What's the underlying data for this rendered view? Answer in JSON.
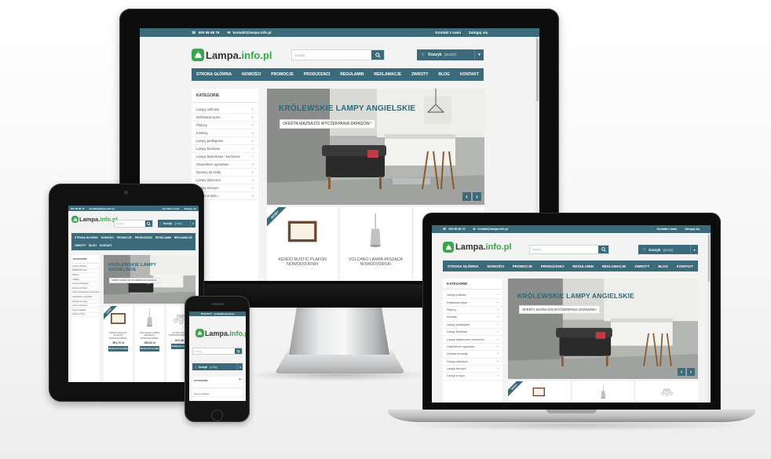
{
  "site": {
    "phone": "600 86 86 76",
    "email": "kontakt@lampa.info.pl",
    "contact_link": "Kontakt z nami",
    "login_link": "Zaloguj się",
    "logo_left": "Lampa.",
    "logo_right": "info.pl",
    "search_placeholder": "Szukaj",
    "cart_label": "Koszyk",
    "cart_state": "(pusty)",
    "nav": [
      "STRONA GŁÓWNA",
      "NOWOŚCI",
      "PROMOCJE",
      "PRODUCENCI",
      "REGULAMIN",
      "REKLAMACJE",
      "ZWROTY",
      "BLOG",
      "KONTAKT"
    ],
    "categories_title": "KATEGORIE",
    "categories": [
      "Lampy sufitowe",
      "Reflektorki tysze",
      "Plafony",
      "Kinkiety",
      "Lampy podłogowe",
      "Lampy biurkowe",
      "Lampy łazienkowe i kuchenne",
      "Oświetlenie ogrodowe",
      "Oprawy do szafy",
      "Lampy dziecięce",
      "Lampy wiszące",
      "Lampy w stylu"
    ],
    "banner_title": "KRÓLEWSKIE LAMPY ANGIELSKIE",
    "banner_subtitle": "OFERTA WAŻNA DO WYCZERPANIA ZAPASÓW !",
    "arrow_prev": "‹",
    "arrow_next": "›",
    "ribbon": "NOWY",
    "products": [
      {
        "name": "KENDO RUSTIC PLAFON NOWODVORSKI",
        "price": "391,72 zł"
      },
      {
        "name": "VOLCANO LAMPA WISZĄCA NOWODVORSKI",
        "price": "190,02 zł"
      },
      {
        "name": "COSTA PLAFON NOWODVORSKI 4122",
        "price": "317,34 zł"
      }
    ],
    "add_to_cart": "Dodaj do koszyka"
  },
  "colors": {
    "brand": "#3b6b7b",
    "logo_green": "#3aa54a",
    "title_blue": "#2e6678"
  }
}
